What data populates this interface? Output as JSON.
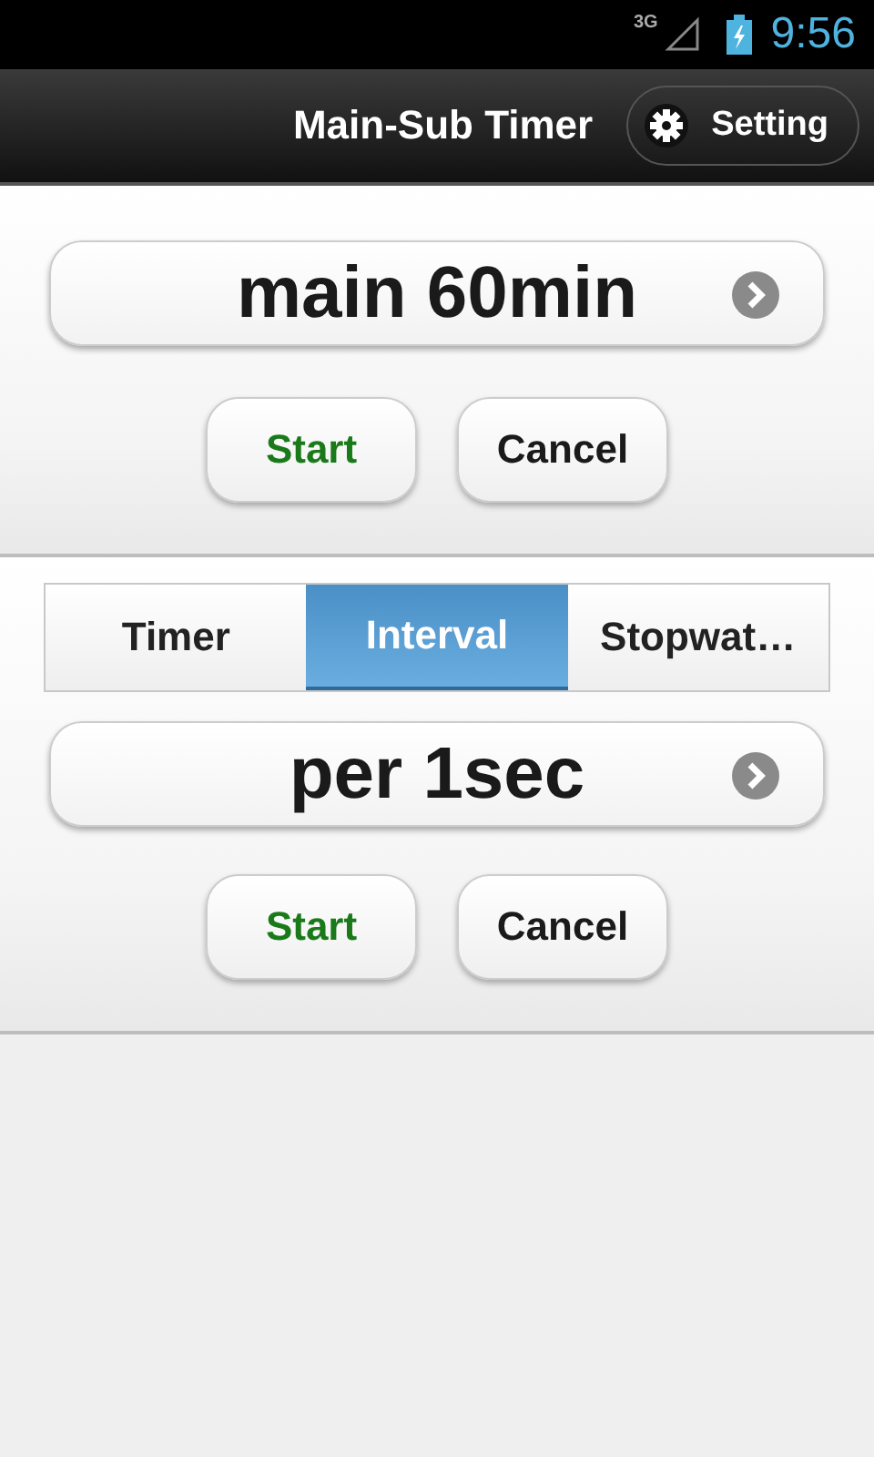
{
  "status_bar": {
    "network": "3G",
    "time": "9:56"
  },
  "header": {
    "title": "Main-Sub Timer",
    "setting_button": "Setting"
  },
  "main_timer": {
    "value": "main 60min",
    "buttons": [
      {
        "label": "Start",
        "kind": "start"
      },
      {
        "label": "Cancel",
        "kind": "cancel"
      }
    ]
  },
  "sub_timer": {
    "tabs": [
      {
        "label": "Timer",
        "selected": false
      },
      {
        "label": "Interval",
        "selected": true
      },
      {
        "label": "Stopwat…",
        "selected": false
      }
    ],
    "value": "per 1sec",
    "buttons": [
      {
        "label": "Start",
        "kind": "start"
      },
      {
        "label": "Cancel",
        "kind": "cancel"
      }
    ]
  }
}
